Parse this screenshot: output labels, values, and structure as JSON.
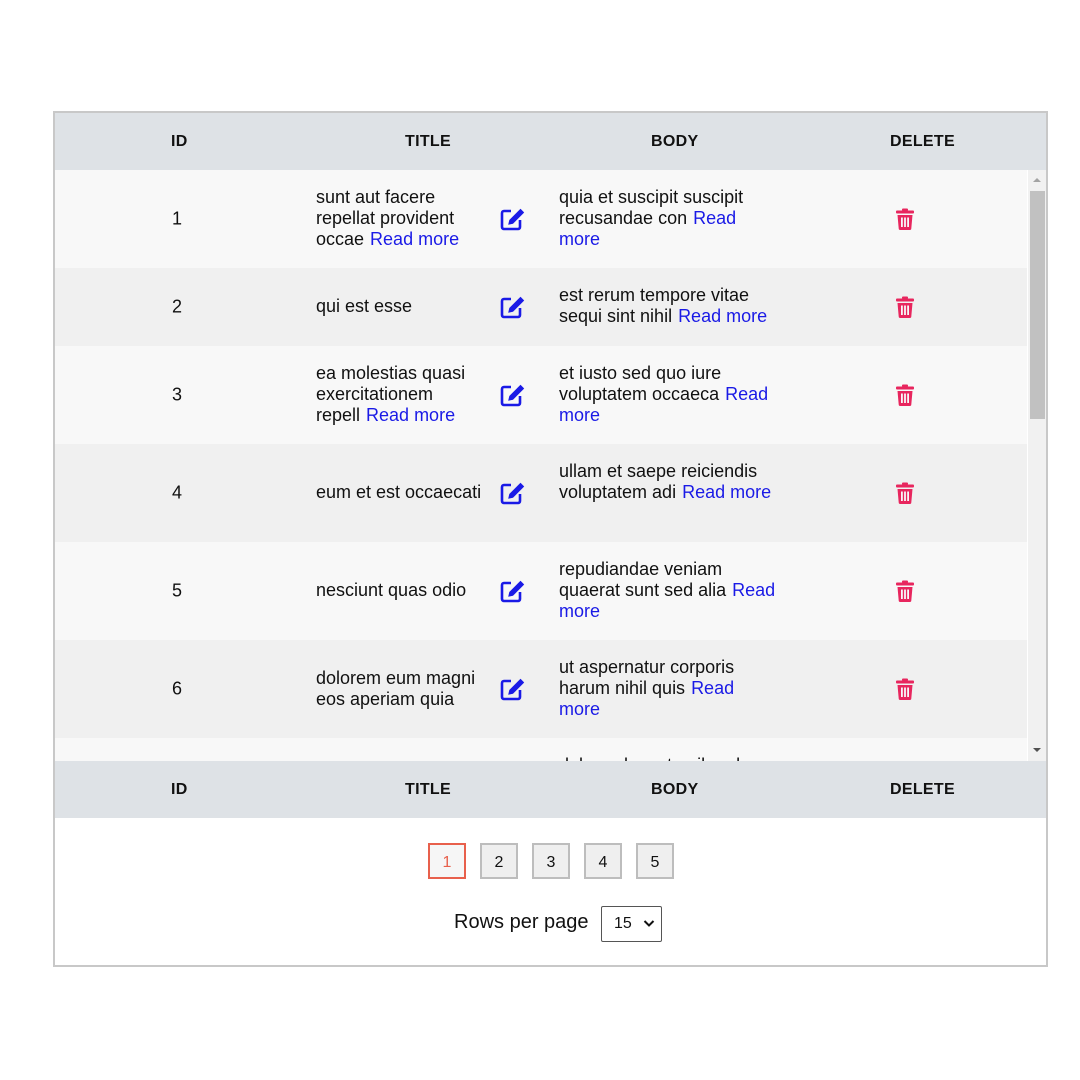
{
  "table": {
    "headers": {
      "id": "ID",
      "title": "TITLE",
      "body": "BODY",
      "delete": "DELETE"
    },
    "read_more_label": "Read more",
    "rows": [
      {
        "id": "1",
        "title": "sunt aut facere repellat provident occae",
        "body": "quia et suscipit suscipit recusandae con"
      },
      {
        "id": "2",
        "title": "qui est esse",
        "body": "est rerum tempore vitae sequi sint nihil"
      },
      {
        "id": "3",
        "title": "ea molestias quasi exercitationem repell",
        "body": "et iusto sed quo iure voluptatem occaeca"
      },
      {
        "id": "4",
        "title": "eum et est occaecati",
        "body": "ullam et saepe reiciendis voluptatem adi"
      },
      {
        "id": "5",
        "title": "nesciunt quas odio",
        "body": "repudiandae veniam quaerat sunt sed alia"
      },
      {
        "id": "6",
        "title": "dolorem eum magni eos aperiam quia",
        "body": "ut aspernatur corporis harum nihil quis"
      },
      {
        "id": "",
        "title": "",
        "body": "dolore placeat quibusdam"
      }
    ]
  },
  "icons": {
    "edit": "edit-icon",
    "delete": "trash-icon"
  },
  "colors": {
    "link": "#1a1ae6",
    "edit_icon": "#1a1ae6",
    "delete_icon": "#e8265e",
    "active_page": "#e8604c",
    "header_bg": "#dee2e6"
  },
  "pagination": {
    "pages": [
      "1",
      "2",
      "3",
      "4",
      "5"
    ],
    "current": "1"
  },
  "rows_per_page": {
    "label": "Rows per page",
    "value": "15"
  }
}
